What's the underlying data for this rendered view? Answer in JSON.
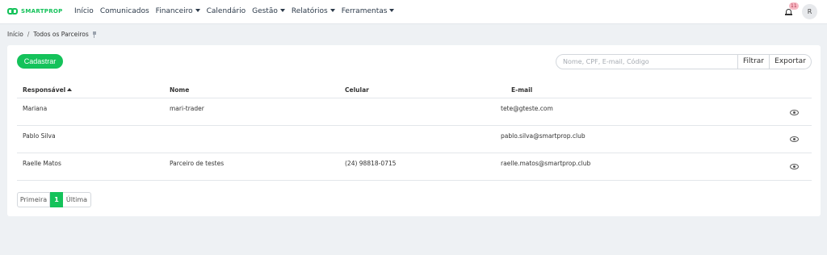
{
  "brand": {
    "name": "SMARTPROP"
  },
  "nav": {
    "items": [
      {
        "label": "Início",
        "dropdown": false
      },
      {
        "label": "Comunicados",
        "dropdown": false
      },
      {
        "label": "Financeiro",
        "dropdown": true
      },
      {
        "label": "Calendário",
        "dropdown": false
      },
      {
        "label": "Gestão",
        "dropdown": true
      },
      {
        "label": "Relatórios",
        "dropdown": true
      },
      {
        "label": "Ferramentas",
        "dropdown": true
      }
    ],
    "notification_count": "11",
    "avatar_initial": "R"
  },
  "breadcrumb": {
    "home": "Início",
    "separator": "/",
    "current": "Todos os Parceiros"
  },
  "toolbar": {
    "add_label": "Cadastrar",
    "search_placeholder": "Nome, CPF, E-mail, Código",
    "filter_label": "Filtrar",
    "export_label": "Exportar"
  },
  "table": {
    "headers": {
      "responsavel": "Responsável",
      "nome": "Nome",
      "celular": "Celular",
      "email": "E-mail"
    },
    "rows": [
      {
        "responsavel": "Mariana",
        "nome": "mari-trader",
        "celular": "",
        "email": "tete@gteste.com"
      },
      {
        "responsavel": "Pablo Silva",
        "nome": "",
        "celular": "",
        "email": "pablo.silva@smartprop.club"
      },
      {
        "responsavel": "Raelle Matos",
        "nome": "Parceiro de testes",
        "celular": "(24) 98818-0715",
        "email": "raelle.matos@smartprop.club"
      }
    ]
  },
  "pagination": {
    "first": "Primeira",
    "current": "1",
    "last": "Última"
  },
  "colors": {
    "accent": "#14c25a",
    "badge_bg": "#f7b9c4",
    "page_bg": "#eef1f4"
  }
}
